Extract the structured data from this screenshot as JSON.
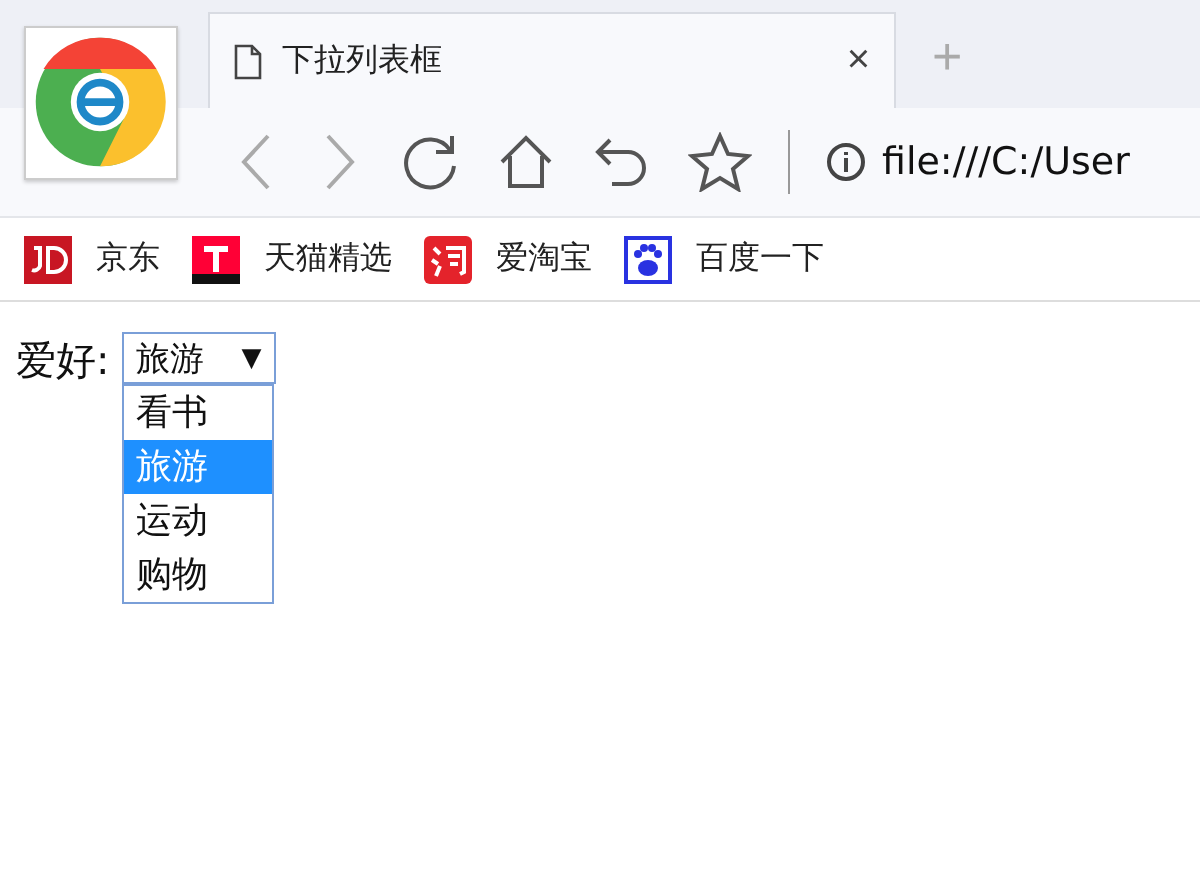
{
  "tab": {
    "title": "下拉列表框",
    "close": "×"
  },
  "new_tab": "+",
  "address": "file:///C:/User",
  "bookmarks": [
    {
      "label": "京东",
      "kind": "jd"
    },
    {
      "label": "天猫精选",
      "kind": "tmall"
    },
    {
      "label": "爱淘宝",
      "kind": "taobao"
    },
    {
      "label": "百度一下",
      "kind": "baidu"
    }
  ],
  "form": {
    "label": "爱好:",
    "select": {
      "value": "旅游",
      "arrow": "▼",
      "expanded": true
    },
    "options": [
      {
        "label": "看书",
        "selected": false
      },
      {
        "label": "旅游",
        "selected": true
      },
      {
        "label": "运动",
        "selected": false
      },
      {
        "label": "购物",
        "selected": false
      }
    ]
  }
}
